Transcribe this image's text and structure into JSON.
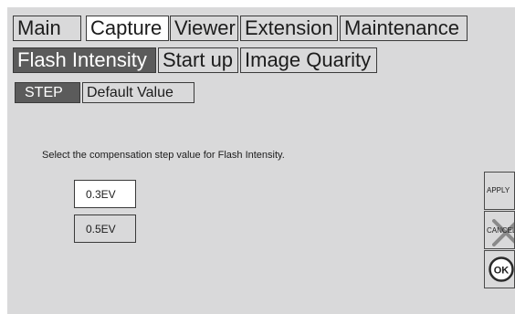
{
  "top_tabs": [
    {
      "label": "Main"
    },
    {
      "label": "Capture"
    },
    {
      "label": "Viewer"
    },
    {
      "label": "Extension"
    },
    {
      "label": "Maintenance"
    }
  ],
  "sub_tabs": [
    {
      "label": "Flash Intensity"
    },
    {
      "label": "Start up"
    },
    {
      "label": "Image Quarity"
    }
  ],
  "setting_tabs": [
    {
      "label": "STEP"
    },
    {
      "label": "Default Value"
    }
  ],
  "instruction": "Select the compensation step value for Flash Intensity.",
  "options": [
    {
      "label": "0.3EV"
    },
    {
      "label": "0.5EV"
    }
  ],
  "side_buttons": {
    "apply_label": "APPLY",
    "cancel_label": "CANCEL",
    "ok_label": "OK"
  },
  "colors": {
    "panel_background": "#d9d9da",
    "selected_dark": "#5b5b5b",
    "selected_light": "#ffffff",
    "border": "#3a3a3a"
  }
}
